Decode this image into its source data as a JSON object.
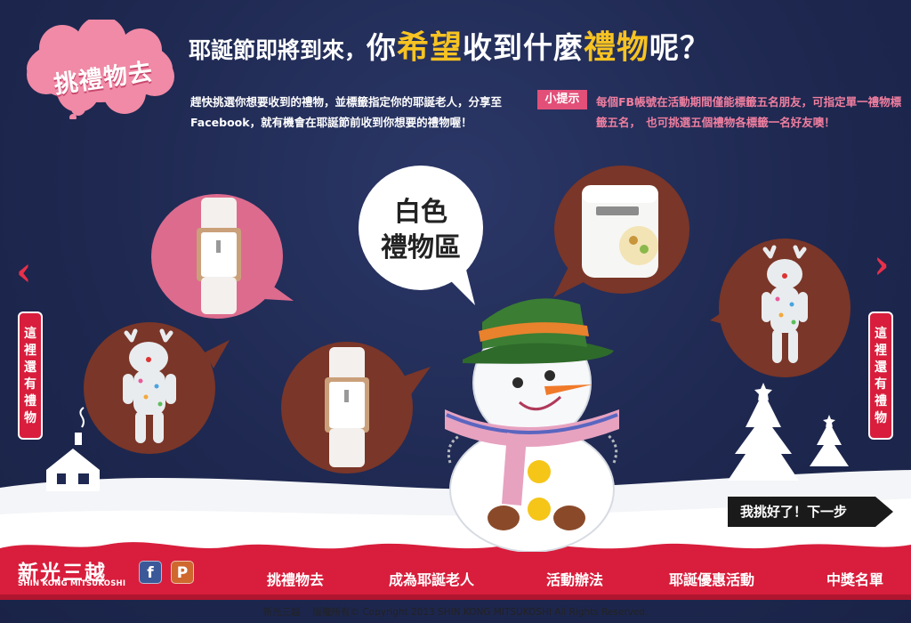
{
  "header": {
    "cloud_label": "挑禮物去",
    "headline_part1": "耶誕節即將到來，",
    "headline_part2": "你",
    "headline_highlight1": "希望",
    "headline_part3": "收到什麼",
    "headline_highlight2": "禮物",
    "headline_part4": "呢？"
  },
  "intro": {
    "text": "趕快挑選你想要收到的禮物，並標籤指定你的耶誕老人，分享至Facebook，就有機會在耶誕節前收到你想要的禮物喔！"
  },
  "tip": {
    "tag": "小提示",
    "text": "每個FB帳號在活動期間僅能標籤五名朋友，可指定單一禮物標籤五名，　也可挑選五個禮物各標籤一名好友噢！"
  },
  "snowman_bubble": {
    "line1": "白色",
    "line2": "禮物區"
  },
  "gifts": [
    {
      "name": "watch",
      "bubble_color": "#dd6b8e"
    },
    {
      "name": "reindeer-plush",
      "bubble_color": "#7a3628"
    },
    {
      "name": "watch",
      "bubble_color": "#7a3628"
    },
    {
      "name": "bread-machine",
      "bubble_color": "#7a3628"
    },
    {
      "name": "reindeer-plush",
      "bubble_color": "#7a3628"
    }
  ],
  "nav_arrows": {
    "left": "‹",
    "right": "›",
    "left_tag": [
      "這",
      "裡",
      "還",
      "有",
      "禮",
      "物"
    ],
    "right_tag": [
      "這",
      "裡",
      "還",
      "有",
      "禮",
      "物"
    ]
  },
  "next_button": {
    "label": "我挑好了！下一步"
  },
  "footer": {
    "logo_cn": "新光三越",
    "logo_en": "SHIN KONG MITSUKOSHI",
    "facebook_icon": "f",
    "plurk_icon": "P",
    "nav": [
      "挑禮物去",
      "成為耶誕老人",
      "活動辦法",
      "耶誕優惠活動",
      "中獎名單"
    ],
    "copyright": "新光三越　 版權所有© Copyright 2013 SHIN KONG MITSUKOSHI All Rights Reserved."
  },
  "colors": {
    "sky": "#1f2952",
    "accent_red": "#d81e3c",
    "pink": "#e24f78",
    "gold": "#f7c322",
    "brown_bubble": "#7a3628"
  }
}
